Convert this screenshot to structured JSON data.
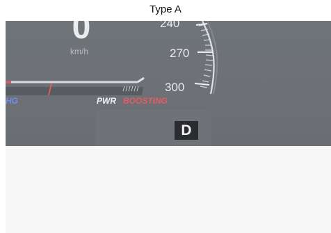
{
  "caption": "Type A",
  "cluster": {
    "speed_value": "0",
    "speed_unit": "km/h",
    "tick_labels": [
      "240",
      "270",
      "300"
    ],
    "hg_label": "HG",
    "power": {
      "label": "PWR",
      "status": "BOOSTING"
    },
    "gear": "D"
  },
  "colors": {
    "cluster_bg": "#6f7479",
    "lower_bg": "#f8f7f8",
    "accent_red": "#e55b63",
    "accent_blue": "#6f8df0",
    "gear_bg": "#2a2c30"
  }
}
